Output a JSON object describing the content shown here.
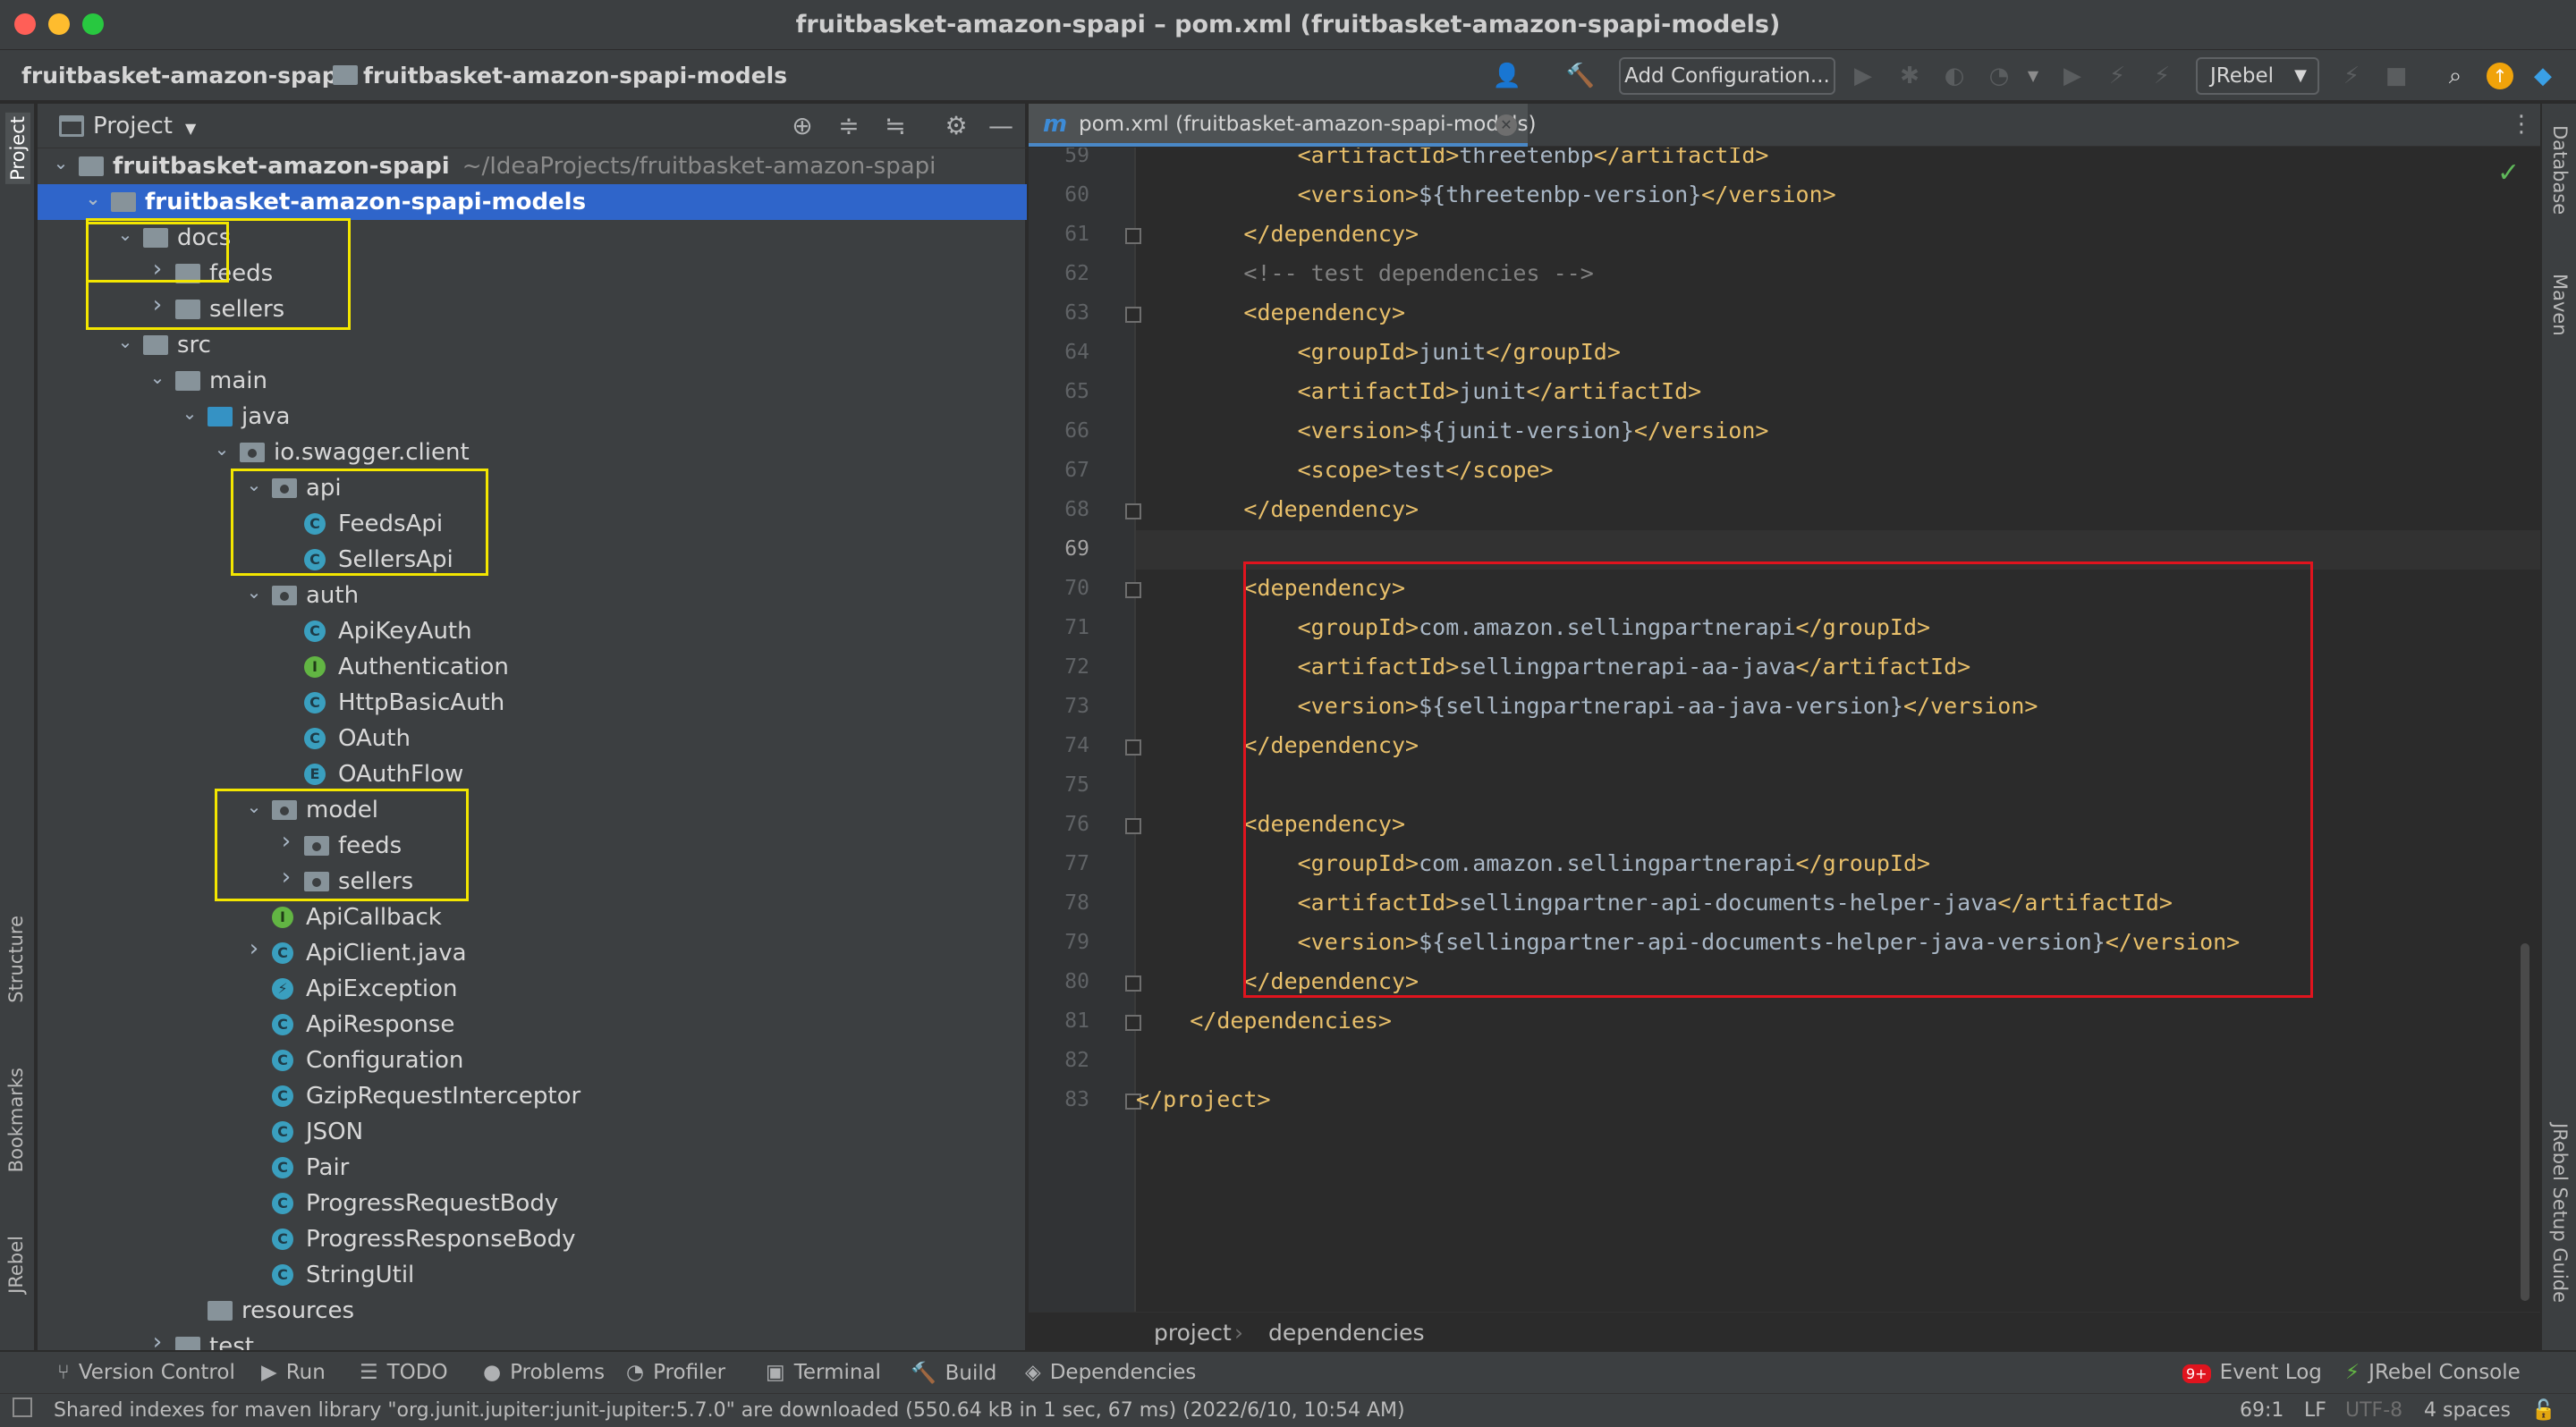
{
  "window": {
    "title": "fruitbasket-amazon-spapi – pom.xml (fruitbasket-amazon-spapi-models)"
  },
  "navbar": {
    "crumbs": [
      "fruitbasket-amazon-spapi",
      "fruitbasket-amazon-spapi-models"
    ],
    "add_configuration": "Add Configuration...",
    "run_config_selected": "JRebel"
  },
  "left_strip": [
    "Project",
    "Structure",
    "Bookmarks",
    "JRebel"
  ],
  "right_strip": [
    "Database",
    "Maven",
    "JRebel Setup Guide"
  ],
  "project_panel": {
    "title": "Project",
    "tree": [
      {
        "label": "fruitbasket-amazon-spapi",
        "path": "~/IdeaProjects/fruitbasket-amazon-spapi",
        "depth": 0,
        "type": "module",
        "expanded": true
      },
      {
        "label": "fruitbasket-amazon-spapi-models",
        "depth": 1,
        "type": "module",
        "expanded": true,
        "selected": true
      },
      {
        "label": "docs",
        "depth": 2,
        "type": "folder",
        "expanded": true
      },
      {
        "label": "feeds",
        "depth": 3,
        "type": "folder",
        "expanded": false
      },
      {
        "label": "sellers",
        "depth": 3,
        "type": "folder",
        "expanded": false
      },
      {
        "label": "src",
        "depth": 2,
        "type": "folder",
        "expanded": true
      },
      {
        "label": "main",
        "depth": 3,
        "type": "folder",
        "expanded": true
      },
      {
        "label": "java",
        "depth": 4,
        "type": "source",
        "expanded": true
      },
      {
        "label": "io.swagger.client",
        "depth": 5,
        "type": "package",
        "expanded": true
      },
      {
        "label": "api",
        "depth": 6,
        "type": "package",
        "expanded": true
      },
      {
        "label": "FeedsApi",
        "depth": 7,
        "type": "class"
      },
      {
        "label": "SellersApi",
        "depth": 7,
        "type": "class"
      },
      {
        "label": "auth",
        "depth": 6,
        "type": "package",
        "expanded": true
      },
      {
        "label": "ApiKeyAuth",
        "depth": 7,
        "type": "class"
      },
      {
        "label": "Authentication",
        "depth": 7,
        "type": "interface"
      },
      {
        "label": "HttpBasicAuth",
        "depth": 7,
        "type": "class"
      },
      {
        "label": "OAuth",
        "depth": 7,
        "type": "class"
      },
      {
        "label": "OAuthFlow",
        "depth": 7,
        "type": "enum"
      },
      {
        "label": "model",
        "depth": 6,
        "type": "package",
        "expanded": true
      },
      {
        "label": "feeds",
        "depth": 7,
        "type": "package",
        "expanded": false
      },
      {
        "label": "sellers",
        "depth": 7,
        "type": "package",
        "expanded": false
      },
      {
        "label": "ApiCallback",
        "depth": 6,
        "type": "interface"
      },
      {
        "label": "ApiClient.java",
        "depth": 6,
        "type": "class",
        "expanded": false
      },
      {
        "label": "ApiException",
        "depth": 6,
        "type": "exception"
      },
      {
        "label": "ApiResponse",
        "depth": 6,
        "type": "class"
      },
      {
        "label": "Configuration",
        "depth": 6,
        "type": "class"
      },
      {
        "label": "GzipRequestInterceptor",
        "depth": 6,
        "type": "class"
      },
      {
        "label": "JSON",
        "depth": 6,
        "type": "class"
      },
      {
        "label": "Pair",
        "depth": 6,
        "type": "class"
      },
      {
        "label": "ProgressRequestBody",
        "depth": 6,
        "type": "class"
      },
      {
        "label": "ProgressResponseBody",
        "depth": 6,
        "type": "class"
      },
      {
        "label": "StringUtil",
        "depth": 6,
        "type": "class"
      },
      {
        "label": "resources",
        "depth": 4,
        "type": "resources"
      },
      {
        "label": "test",
        "depth": 3,
        "type": "folder",
        "expanded": false
      }
    ]
  },
  "editor": {
    "tab_label": "pom.xml (fruitbasket-amazon-spapi-models)",
    "current_line": 69,
    "lines": [
      {
        "n": 59,
        "text": "            <artifactId>threetenbp</artifactId>"
      },
      {
        "n": 60,
        "text": "            <version>${threetenbp-version}</version>"
      },
      {
        "n": 61,
        "text": "        </dependency>"
      },
      {
        "n": 62,
        "text": "        <!-- test dependencies -->"
      },
      {
        "n": 63,
        "text": "        <dependency>"
      },
      {
        "n": 64,
        "text": "            <groupId>junit</groupId>"
      },
      {
        "n": 65,
        "text": "            <artifactId>junit</artifactId>"
      },
      {
        "n": 66,
        "text": "            <version>${junit-version}</version>"
      },
      {
        "n": 67,
        "text": "            <scope>test</scope>"
      },
      {
        "n": 68,
        "text": "        </dependency>"
      },
      {
        "n": 69,
        "text": ""
      },
      {
        "n": 70,
        "text": "        <dependency>"
      },
      {
        "n": 71,
        "text": "            <groupId>com.amazon.sellingpartnerapi</groupId>"
      },
      {
        "n": 72,
        "text": "            <artifactId>sellingpartnerapi-aa-java</artifactId>"
      },
      {
        "n": 73,
        "text": "            <version>${sellingpartnerapi-aa-java-version}</version>"
      },
      {
        "n": 74,
        "text": "        </dependency>"
      },
      {
        "n": 75,
        "text": ""
      },
      {
        "n": 76,
        "text": "        <dependency>"
      },
      {
        "n": 77,
        "text": "            <groupId>com.amazon.sellingpartnerapi</groupId>"
      },
      {
        "n": 78,
        "text": "            <artifactId>sellingpartner-api-documents-helper-java</artifactId>"
      },
      {
        "n": 79,
        "text": "            <version>${sellingpartner-api-documents-helper-java-version}</version>"
      },
      {
        "n": 80,
        "text": "        </dependency>"
      },
      {
        "n": 81,
        "text": "    </dependencies>"
      },
      {
        "n": 82,
        "text": ""
      },
      {
        "n": 83,
        "text": "</project>"
      }
    ],
    "breadcrumb": [
      "project",
      "dependencies"
    ]
  },
  "tool_windows": [
    {
      "label": "Version Control",
      "icon": "branch-icon"
    },
    {
      "label": "Run",
      "icon": "play-icon"
    },
    {
      "label": "TODO",
      "icon": "list-icon"
    },
    {
      "label": "Problems",
      "icon": "warning-icon"
    },
    {
      "label": "Profiler",
      "icon": "profiler-icon"
    },
    {
      "label": "Terminal",
      "icon": "terminal-icon"
    },
    {
      "label": "Build",
      "icon": "hammer-icon"
    },
    {
      "label": "Dependencies",
      "icon": "layers-icon"
    }
  ],
  "tool_windows_right": [
    {
      "label": "Event Log",
      "badge": "9+"
    },
    {
      "label": "JRebel Console"
    }
  ],
  "status": {
    "message": "Shared indexes for maven library \"org.junit.jupiter:junit-jupiter:5.7.0\" are downloaded (550.64 kB in 1 sec, 67 ms) (2022/6/10, 10:54 AM)",
    "position": "69:1",
    "line_sep": "LF",
    "encoding": "UTF-8",
    "indent": "4 spaces"
  },
  "colors": {
    "selection": "#2f65ca",
    "highlight_yellow": "#f3e600",
    "highlight_red": "#e0141e",
    "xml_tag": "#e8bf6a",
    "xml_text": "#a9b7c6"
  }
}
